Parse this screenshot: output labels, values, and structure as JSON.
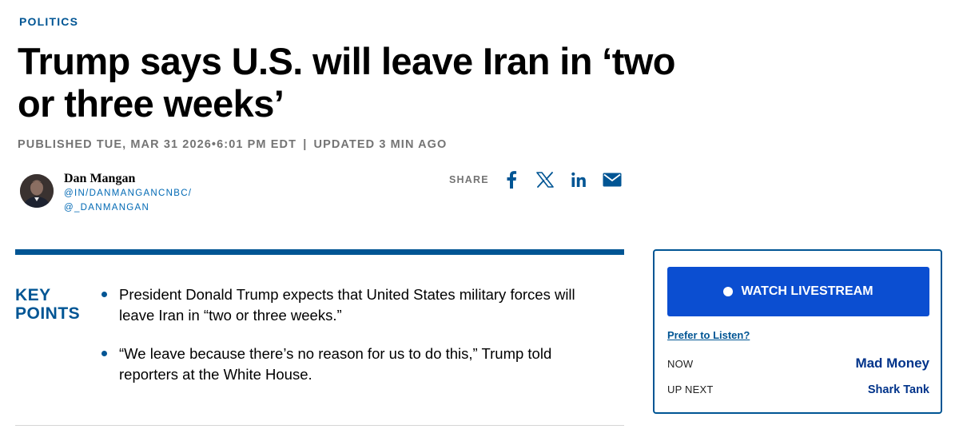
{
  "article": {
    "section": "POLITICS",
    "headline": "Trump says U.S. will leave Iran in ‘two or three weeks’",
    "published": "PUBLISHED TUE, MAR 31 2026•6:01 PM EDT",
    "separator": "|",
    "updated": "UPDATED 3 MIN AGO"
  },
  "author": {
    "name": "Dan Mangan",
    "linkedin": "@IN/DANMANGANCNBC/",
    "twitter": "@_DANMANGAN"
  },
  "share": {
    "label": "SHARE",
    "icons": [
      "facebook-icon",
      "x-icon",
      "linkedin-icon",
      "email-icon"
    ]
  },
  "key_points": {
    "label": "KEY POINTS",
    "items": [
      "President Donald Trump expects that United States military forces will leave Iran in “two or three weeks.”",
      "“We leave because there’s no reason for us to do this,” Trump told reporters at the White House."
    ]
  },
  "live": {
    "button_label": "WATCH LIVESTREAM",
    "listen_label": "Prefer to Listen?",
    "now_label": "NOW",
    "now_show": "Mad Money",
    "next_label": "UP NEXT",
    "next_show": "Shark Tank"
  },
  "colors": {
    "brand_blue": "#005594",
    "button_blue": "#0b4ed1",
    "link_blue": "#0069b4",
    "meta_gray": "#747474"
  }
}
